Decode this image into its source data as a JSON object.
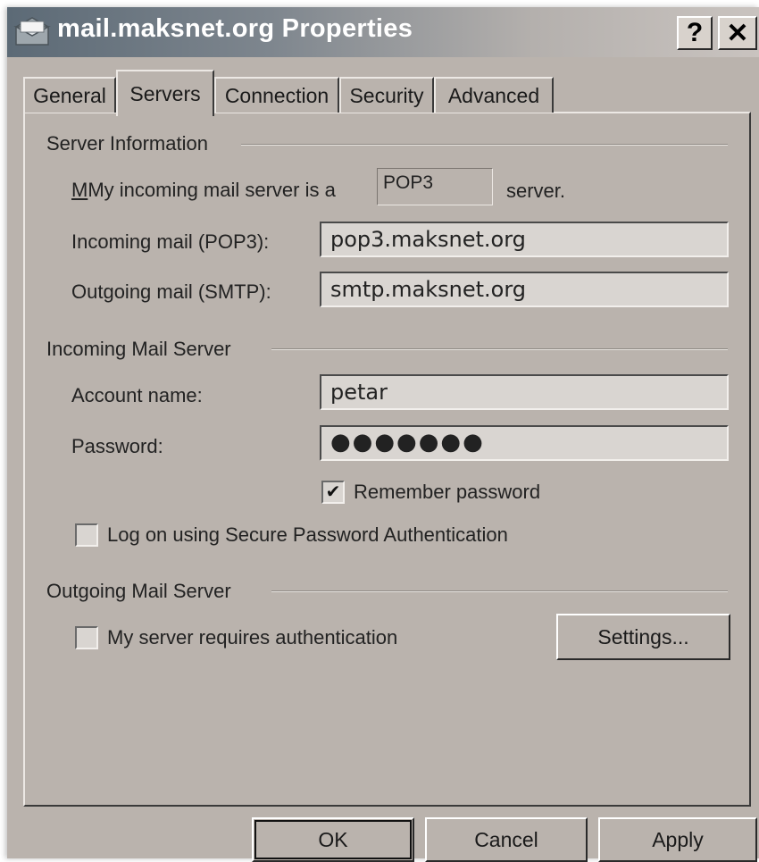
{
  "window": {
    "title": "mail.maksnet.org Properties",
    "help_button": "?",
    "close_button": "✕"
  },
  "tabs": [
    {
      "label": "General",
      "active": false
    },
    {
      "label": "Servers",
      "active": true
    },
    {
      "label": "Connection",
      "active": false
    },
    {
      "label": "Security",
      "active": false
    },
    {
      "label": "Advanced",
      "active": false
    }
  ],
  "server_information": {
    "group_title": "Server Information",
    "incoming_type_prefix": "My incoming mail server is a",
    "incoming_type_value": "POP3",
    "incoming_type_suffix": "server.",
    "incoming_label": "Incoming mail (POP3):",
    "incoming_value": "pop3.maksnet.org",
    "outgoing_label": "Outgoing mail (SMTP):",
    "outgoing_value": "smtp.maksnet.org"
  },
  "incoming_mail_server": {
    "group_title": "Incoming Mail Server",
    "account_label": "Account name:",
    "account_value": "petar",
    "password_label": "Password:",
    "password_value": "●●●●●●●",
    "remember_password_label": "Remember password",
    "remember_password_checked": true,
    "spa_label": "Log on using Secure Password Authentication",
    "spa_checked": false
  },
  "outgoing_mail_server": {
    "group_title": "Outgoing Mail Server",
    "requires_auth_label": "My server requires authentication",
    "requires_auth_checked": false,
    "settings_button": "Settings..."
  },
  "footer": {
    "ok": "OK",
    "cancel": "Cancel",
    "apply": "Apply"
  },
  "colors": {
    "dialog_background": "#bab3ad",
    "titlebar_start": "#5c6a76",
    "titlebar_end": "#c9c3bf"
  }
}
